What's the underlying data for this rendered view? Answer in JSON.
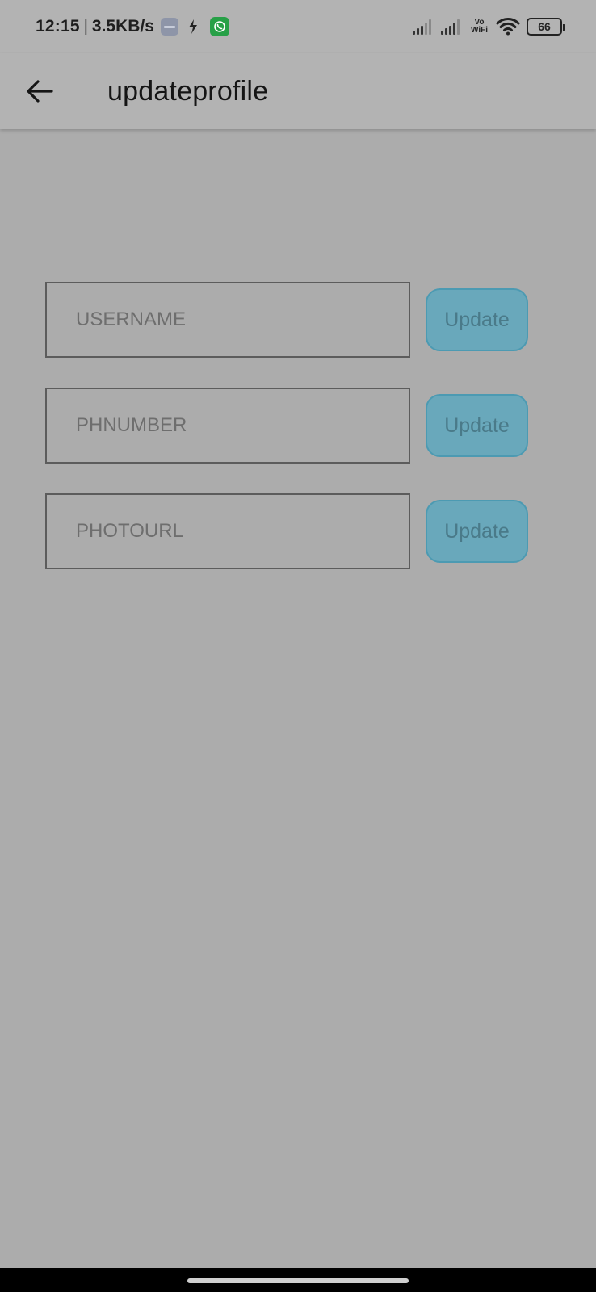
{
  "status_bar": {
    "time": "12:15",
    "separator": "|",
    "net_speed": "3.5KB/s",
    "vowifi_top": "Vo",
    "vowifi_bottom": "WiFi",
    "battery_level": "66",
    "icons": [
      "app-icon",
      "bluetooth-bolt-icon",
      "whatsapp-icon",
      "signal-icon",
      "signal-icon",
      "wifi-icon",
      "battery-icon"
    ]
  },
  "app_bar": {
    "title": "updateprofile",
    "back_icon": "arrow-left-icon"
  },
  "form": {
    "rows": [
      {
        "placeholder": "USERNAME",
        "value": "",
        "button_label": "Update"
      },
      {
        "placeholder": "PHNUMBER",
        "value": "",
        "button_label": "Update"
      },
      {
        "placeholder": "PHOTOURL",
        "value": "",
        "button_label": "Update"
      }
    ]
  },
  "colors": {
    "background": "#acacac",
    "app_bar": "#b3b3b3",
    "button_fill": "#69a8bb",
    "button_border": "#4c9ab2",
    "button_text": "#4a7a89"
  }
}
